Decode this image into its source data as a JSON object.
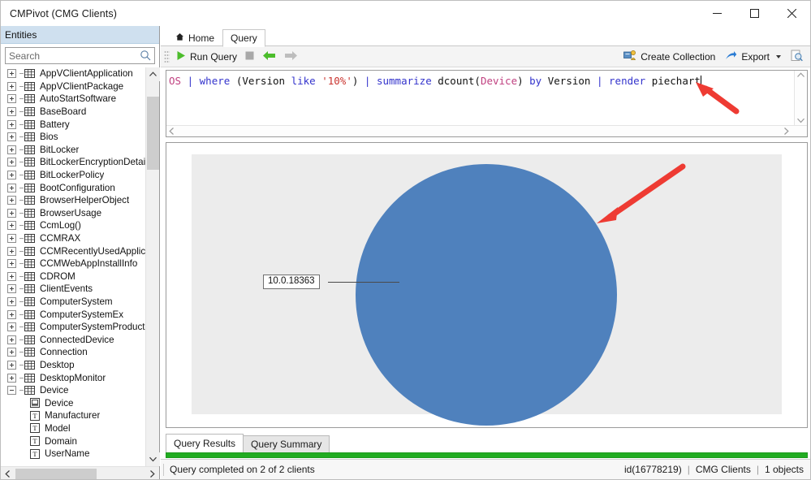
{
  "window": {
    "title": "CMPivot (CMG Clients)",
    "controls": [
      {
        "name": "minimize-button",
        "glyph": "minimize"
      },
      {
        "name": "maximize-button",
        "glyph": "maximize"
      },
      {
        "name": "close-button",
        "glyph": "close"
      }
    ]
  },
  "sidebar": {
    "header": "Entities",
    "search": {
      "value": "",
      "placeholder": "Search",
      "icon": "search-icon"
    },
    "entities": [
      {
        "label": "AppVClientApplication",
        "icon": "table-icon",
        "expanded": false
      },
      {
        "label": "AppVClientPackage",
        "icon": "table-icon",
        "expanded": false
      },
      {
        "label": "AutoStartSoftware",
        "icon": "table-icon",
        "expanded": false
      },
      {
        "label": "BaseBoard",
        "icon": "table-icon",
        "expanded": false
      },
      {
        "label": "Battery",
        "icon": "table-icon",
        "expanded": false
      },
      {
        "label": "Bios",
        "icon": "table-icon",
        "expanded": false
      },
      {
        "label": "BitLocker",
        "icon": "table-icon",
        "expanded": false
      },
      {
        "label": "BitLockerEncryptionDetails",
        "icon": "table-icon",
        "expanded": false
      },
      {
        "label": "BitLockerPolicy",
        "icon": "table-icon",
        "expanded": false
      },
      {
        "label": "BootConfiguration",
        "icon": "table-icon",
        "expanded": false
      },
      {
        "label": "BrowserHelperObject",
        "icon": "table-icon",
        "expanded": false
      },
      {
        "label": "BrowserUsage",
        "icon": "table-icon",
        "expanded": false
      },
      {
        "label": "CcmLog()",
        "icon": "table-icon",
        "expanded": false
      },
      {
        "label": "CCMRAX",
        "icon": "table-icon",
        "expanded": false
      },
      {
        "label": "CCMRecentlyUsedApplicat",
        "icon": "table-icon",
        "expanded": false
      },
      {
        "label": "CCMWebAppInstallInfo",
        "icon": "table-icon",
        "expanded": false
      },
      {
        "label": "CDROM",
        "icon": "table-icon",
        "expanded": false
      },
      {
        "label": "ClientEvents",
        "icon": "table-icon",
        "expanded": false
      },
      {
        "label": "ComputerSystem",
        "icon": "table-icon",
        "expanded": false
      },
      {
        "label": "ComputerSystemEx",
        "icon": "table-icon",
        "expanded": false
      },
      {
        "label": "ComputerSystemProduct",
        "icon": "table-icon",
        "expanded": false
      },
      {
        "label": "ConnectedDevice",
        "icon": "table-icon",
        "expanded": false
      },
      {
        "label": "Connection",
        "icon": "table-icon",
        "expanded": false
      },
      {
        "label": "Desktop",
        "icon": "table-icon",
        "expanded": false
      },
      {
        "label": "DesktopMonitor",
        "icon": "table-icon",
        "expanded": false
      },
      {
        "label": "Device",
        "icon": "table-icon",
        "expanded": true
      }
    ],
    "device_attributes": [
      {
        "label": "Device",
        "icon": "device-attribute-icon"
      },
      {
        "label": "Manufacturer",
        "icon": "text-attribute-icon"
      },
      {
        "label": "Model",
        "icon": "text-attribute-icon"
      },
      {
        "label": "Domain",
        "icon": "text-attribute-icon"
      },
      {
        "label": "UserName",
        "icon": "text-attribute-icon"
      }
    ]
  },
  "tabs": [
    {
      "label": "Home",
      "icon": "home-icon",
      "active": false
    },
    {
      "label": "Query",
      "icon": "",
      "active": true
    }
  ],
  "toolbar": {
    "run_query": "Run Query",
    "stop_icon": "stop-icon",
    "back_icon": "back-arrow-icon",
    "forward_icon": "forward-arrow-icon",
    "create_collection": "Create Collection",
    "export": "Export",
    "search_results_icon": "search-results-icon"
  },
  "query": {
    "tokens": [
      {
        "text": "OS",
        "color": "#c04080"
      },
      {
        "text": " ",
        "color": "#111111"
      },
      {
        "text": "|",
        "color": "#3333cc"
      },
      {
        "text": " ",
        "color": "#111111"
      },
      {
        "text": "where",
        "color": "#3333cc"
      },
      {
        "text": " (",
        "color": "#111111"
      },
      {
        "text": "Version",
        "color": "#111111"
      },
      {
        "text": " ",
        "color": "#111111"
      },
      {
        "text": "like",
        "color": "#3333cc"
      },
      {
        "text": " ",
        "color": "#111111"
      },
      {
        "text": "'10%'",
        "color": "#c9332e"
      },
      {
        "text": ")",
        "color": "#111111"
      },
      {
        "text": " ",
        "color": "#111111"
      },
      {
        "text": "|",
        "color": "#3333cc"
      },
      {
        "text": " ",
        "color": "#111111"
      },
      {
        "text": "summarize",
        "color": "#3333cc"
      },
      {
        "text": " dcount(",
        "color": "#111111"
      },
      {
        "text": "Device",
        "color": "#c04080"
      },
      {
        "text": ") ",
        "color": "#111111"
      },
      {
        "text": "by",
        "color": "#3333cc"
      },
      {
        "text": " Version ",
        "color": "#111111"
      },
      {
        "text": "|",
        "color": "#3333cc"
      },
      {
        "text": " ",
        "color": "#111111"
      },
      {
        "text": "render",
        "color": "#3333cc"
      },
      {
        "text": " piechart",
        "color": "#111111"
      }
    ],
    "plain_text": "OS | where (Version like '10%') | summarize dcount(Device) by Version | render piechart"
  },
  "chart_data": {
    "type": "pie",
    "title": "",
    "categories": [
      "10.0.18363"
    ],
    "values": [
      1
    ],
    "labels": [
      "10.0.18363"
    ],
    "colors": [
      "#4f81bd"
    ],
    "legend_position": "none",
    "plot_background": "#ececec",
    "annotations": [
      {
        "name": "red-arrow-to-pie",
        "direction": "down-left",
        "color": "#ee3b33"
      },
      {
        "name": "red-arrow-to-query",
        "direction": "up-left",
        "color": "#ee3b33"
      }
    ]
  },
  "result_tabs": [
    {
      "label": "Query Results",
      "active": true
    },
    {
      "label": "Query Summary",
      "active": false
    }
  ],
  "progress": {
    "percent": 100,
    "color": "#22ac22"
  },
  "statusbar": {
    "message": "Query completed on 2 of 2 clients",
    "id": "id(16778219)",
    "sep1": "|",
    "collection": "CMG Clients",
    "sep2": "|",
    "objects": "1 objects"
  }
}
